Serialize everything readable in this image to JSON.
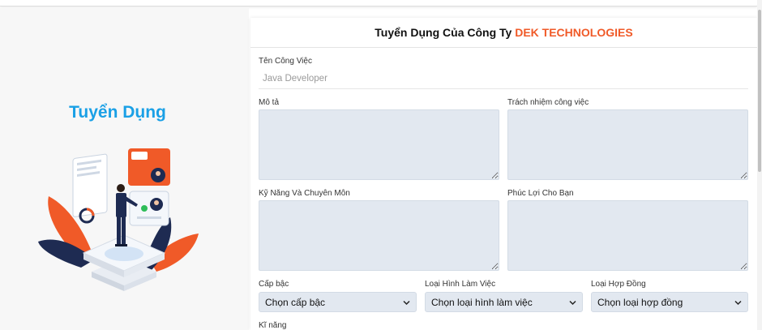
{
  "left": {
    "title": "Tuyển Dụng"
  },
  "form": {
    "title_prefix": "Tuyển Dụng Của Công Ty",
    "company": "DEK TECHNOLOGIES",
    "job_name_label": "Tên Công Việc",
    "job_name_placeholder": "Java Developer",
    "description_label": "Mô tả",
    "responsibilities_label": "Trách nhiệm công việc",
    "skills_expertise_label": "Kỹ Năng Và Chuyên Môn",
    "benefits_label": "Phúc Lợi Cho Bạn",
    "level_label": "Cấp bậc",
    "level_value": "Chọn cấp bậc",
    "work_type_label": "Loại Hình Làm Việc",
    "work_type_value": "Chọn loại hình làm việc",
    "contract_label": "Loại Hợp Đồng",
    "contract_value": "Chọn loại hợp đồng",
    "skills_label": "Kĩ năng"
  },
  "colors": {
    "brand_orange": "#f05a28",
    "title_blue": "#1aa0e6",
    "field_bg": "#e2e8f0",
    "navy": "#1e2b52"
  },
  "icons": [
    "recruitment-illustration",
    "chevron-down-icon"
  ]
}
